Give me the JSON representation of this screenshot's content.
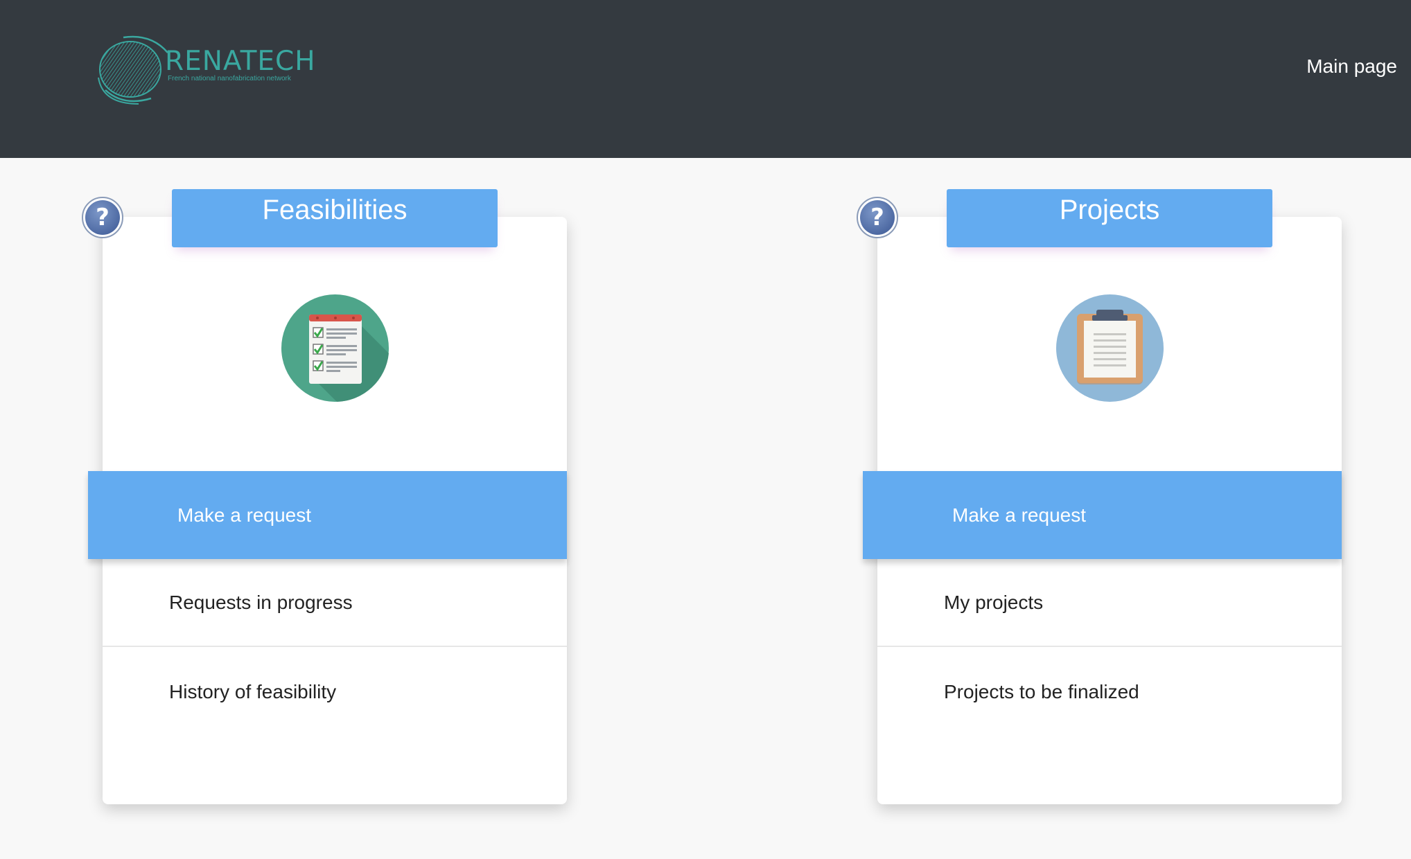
{
  "header": {
    "logo": {
      "word": "RENATECH",
      "tagline": "French national nanofabrication network"
    },
    "nav": {
      "main_page": "Main page"
    }
  },
  "feasibilities": {
    "title": "Feasibilities",
    "help": "?",
    "illustration_icon": "checklist-icon",
    "primary_action": "Make a request",
    "items": [
      "Requests in progress",
      "History of feasibility"
    ]
  },
  "projects": {
    "title": "Projects",
    "help": "?",
    "illustration_icon": "clipboard-icon",
    "primary_action": "Make a request",
    "items": [
      "My projects",
      "Projects to be finalized"
    ]
  },
  "colors": {
    "header_bg": "#343a40",
    "accent_blue": "#63abf0",
    "logo_teal": "#3aa8a0",
    "page_bg": "#f8f8f8"
  }
}
